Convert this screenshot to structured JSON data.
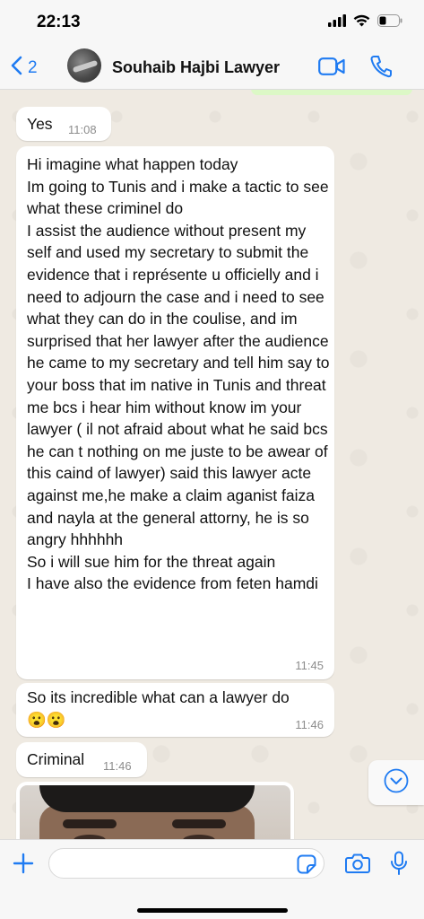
{
  "status_bar": {
    "time": "22:13"
  },
  "header": {
    "back_count": "2",
    "contact_name": "Souhaib Hajbi Lawyer",
    "icons": {
      "back": "chevron-left-icon",
      "video": "video-camera-icon",
      "call": "phone-icon"
    }
  },
  "messages": [
    {
      "text": "Yes",
      "time": "11:08"
    },
    {
      "text": "Hi imagine what happen today\nIm going to Tunis and i make a tactic to see what these criminel do\nI assist the audience without present my self and used my secretary to submit the evidence that i représente u officielly and i need to adjourn the case and i need to see what they can do in the coulise, and im surprised that her lawyer after the audience he came to my secretary and tell him say to your boss that im native in Tunis and threat me bcs i hear him without know im your lawyer ( il not afraid about what he said bcs he can t nothing on me juste to be awear of this caind of lawyer) said this lawyer acte against me,he make  a claim aganist faiza and nayla at the general attorny, he is so angry hhhhhh\nSo i will sue him for the threat again\nI have also the evidence from feten hamdi",
      "time": "11:45"
    },
    {
      "text": "So its incredible what can a lawyer do\n😮😮",
      "time": "11:46"
    },
    {
      "text": "Criminal",
      "time": "11:46"
    }
  ],
  "input_bar": {
    "placeholder": "",
    "icons": {
      "plus": "plus-icon",
      "sticker": "sticker-icon",
      "camera": "camera-icon",
      "mic": "microphone-icon",
      "scroll_down": "chevron-down-icon"
    }
  },
  "colors": {
    "accent": "#1f7bf2",
    "background": "#efeae2",
    "bubble_in": "#ffffff",
    "bubble_out": "#dcf8c6"
  }
}
